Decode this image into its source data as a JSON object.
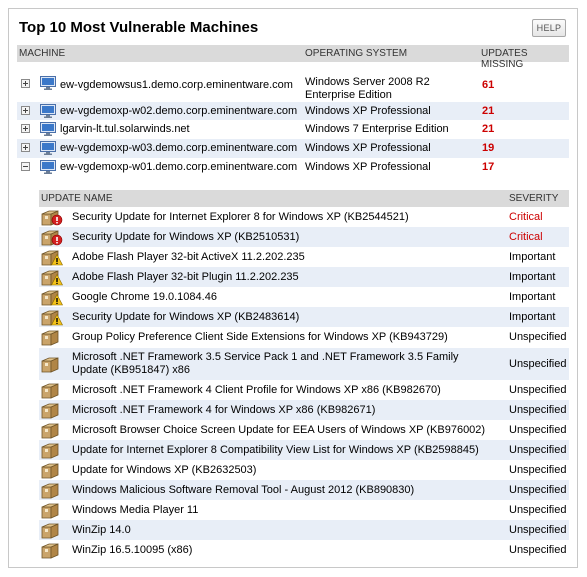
{
  "widget": {
    "title": "Top 10 Most Vulnerable Machines",
    "help_label": "HELP"
  },
  "machines_table": {
    "headers": {
      "machine": "MACHINE",
      "os": "OPERATING SYSTEM",
      "updates": "UPDATES MISSING"
    },
    "rows": [
      {
        "name": "ew-vgdemowsus1.demo.corp.eminentware.com",
        "os": "Windows Server 2008 R2 Enterprise Edition",
        "missing": "61",
        "expanded": false
      },
      {
        "name": "ew-vgdemoxp-w02.demo.corp.eminentware.com",
        "os": "Windows XP Professional",
        "missing": "21",
        "expanded": false
      },
      {
        "name": "lgarvin-lt.tul.solarwinds.net",
        "os": "Windows 7 Enterprise Edition",
        "missing": "21",
        "expanded": false
      },
      {
        "name": "ew-vgdemoxp-w03.demo.corp.eminentware.com",
        "os": "Windows XP Professional",
        "missing": "19",
        "expanded": false
      },
      {
        "name": "ew-vgdemoxp-w01.demo.corp.eminentware.com",
        "os": "Windows XP Professional",
        "missing": "17",
        "expanded": true
      }
    ]
  },
  "updates_table": {
    "headers": {
      "name": "UPDATE NAME",
      "severity": "SEVERITY"
    },
    "rows": [
      {
        "name": "Security Update for Internet Explorer 8 for Windows XP (KB2544521)",
        "severity": "Critical",
        "icon": "critical-update-icon"
      },
      {
        "name": "Security Update for Windows XP (KB2510531)",
        "severity": "Critical",
        "icon": "critical-update-icon"
      },
      {
        "name": "Adobe Flash Player 32-bit ActiveX 11.2.202.235",
        "severity": "Important",
        "icon": "important-update-icon"
      },
      {
        "name": "Adobe Flash Player 32-bit Plugin 11.2.202.235",
        "severity": "Important",
        "icon": "important-update-icon"
      },
      {
        "name": "Google Chrome 19.0.1084.46",
        "severity": "Important",
        "icon": "important-update-icon"
      },
      {
        "name": "Security Update for Windows XP (KB2483614)",
        "severity": "Important",
        "icon": "important-update-icon"
      },
      {
        "name": "Group Policy Preference Client Side Extensions for Windows XP (KB943729)",
        "severity": "Unspecified",
        "icon": "package-icon"
      },
      {
        "name": "Microsoft .NET Framework 3.5 Service Pack 1 and .NET Framework 3.5 Family Update (KB951847) x86",
        "severity": "Unspecified",
        "icon": "package-icon"
      },
      {
        "name": "Microsoft .NET Framework 4 Client Profile for Windows XP x86 (KB982670)",
        "severity": "Unspecified",
        "icon": "package-icon"
      },
      {
        "name": "Microsoft .NET Framework 4 for Windows XP x86 (KB982671)",
        "severity": "Unspecified",
        "icon": "package-icon"
      },
      {
        "name": "Microsoft Browser Choice Screen Update for EEA Users of Windows XP (KB976002)",
        "severity": "Unspecified",
        "icon": "package-icon"
      },
      {
        "name": "Update for Internet Explorer 8 Compatibility View List for Windows XP (KB2598845)",
        "severity": "Unspecified",
        "icon": "package-icon"
      },
      {
        "name": "Update for Windows XP (KB2632503)",
        "severity": "Unspecified",
        "icon": "package-icon"
      },
      {
        "name": "Windows Malicious Software Removal Tool - August 2012 (KB890830)",
        "severity": "Unspecified",
        "icon": "package-icon"
      },
      {
        "name": "Windows Media Player 11",
        "severity": "Unspecified",
        "icon": "package-icon"
      },
      {
        "name": "WinZip 14.0",
        "severity": "Unspecified",
        "icon": "package-icon"
      },
      {
        "name": "WinZip 16.5.10095 (x86)",
        "severity": "Unspecified",
        "icon": "package-icon"
      }
    ]
  },
  "colors": {
    "critical": "#cc0000",
    "count": "#cc0000",
    "row_alt": "#e8eef7",
    "header_bg": "#dadada"
  }
}
